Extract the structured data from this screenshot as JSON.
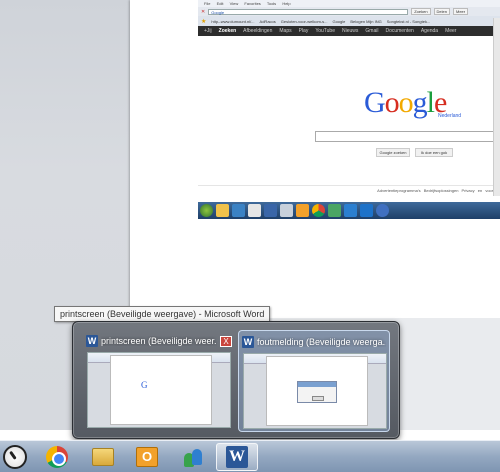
{
  "browser": {
    "menu": [
      "File",
      "Edit",
      "View",
      "Favorites",
      "Tools",
      "Help"
    ],
    "address": "Google",
    "address_buttons": [
      "Zoeken",
      "Delen",
      "Meer"
    ],
    "favorites": [
      "http--www.dumount.nl/...",
      "AdRacos",
      "Gesloten-voor-welkom-s...",
      "Google",
      "Belogen Mijn ING",
      "Songtekst.nl - Songtek..."
    ],
    "google_bar": [
      "+Jij",
      "Zoeken",
      "Afbeeldingen",
      "Maps",
      "Play",
      "YouTube",
      "Nieuws",
      "Gmail",
      "Documenten",
      "Agenda",
      "Meer"
    ],
    "google_bar_active": 1,
    "logo_letters": [
      "G",
      "o",
      "o",
      "g",
      "l",
      "e"
    ],
    "logo_sub": "Nederland",
    "btn_search": "Google zoeken",
    "btn_lucky": "Ik doe een gok",
    "footer": "Advertentieprogramma's  Bedrijfsoplossingen  Privacy en voorw"
  },
  "tooltip": "printscreen (Beveiligde weergave) - Microsoft Word",
  "thumbnails": [
    {
      "title": "printscreen (Beveiligde weer...",
      "close": "X"
    },
    {
      "title": "foutmelding (Beveiligde weerga..."
    }
  ],
  "taskbar": {
    "items": [
      "start",
      "google-chrome",
      "windows-explorer",
      "outlook",
      "windows-live-messenger",
      "microsoft-word"
    ],
    "word_glyph": "W",
    "outlook_glyph": "O"
  }
}
